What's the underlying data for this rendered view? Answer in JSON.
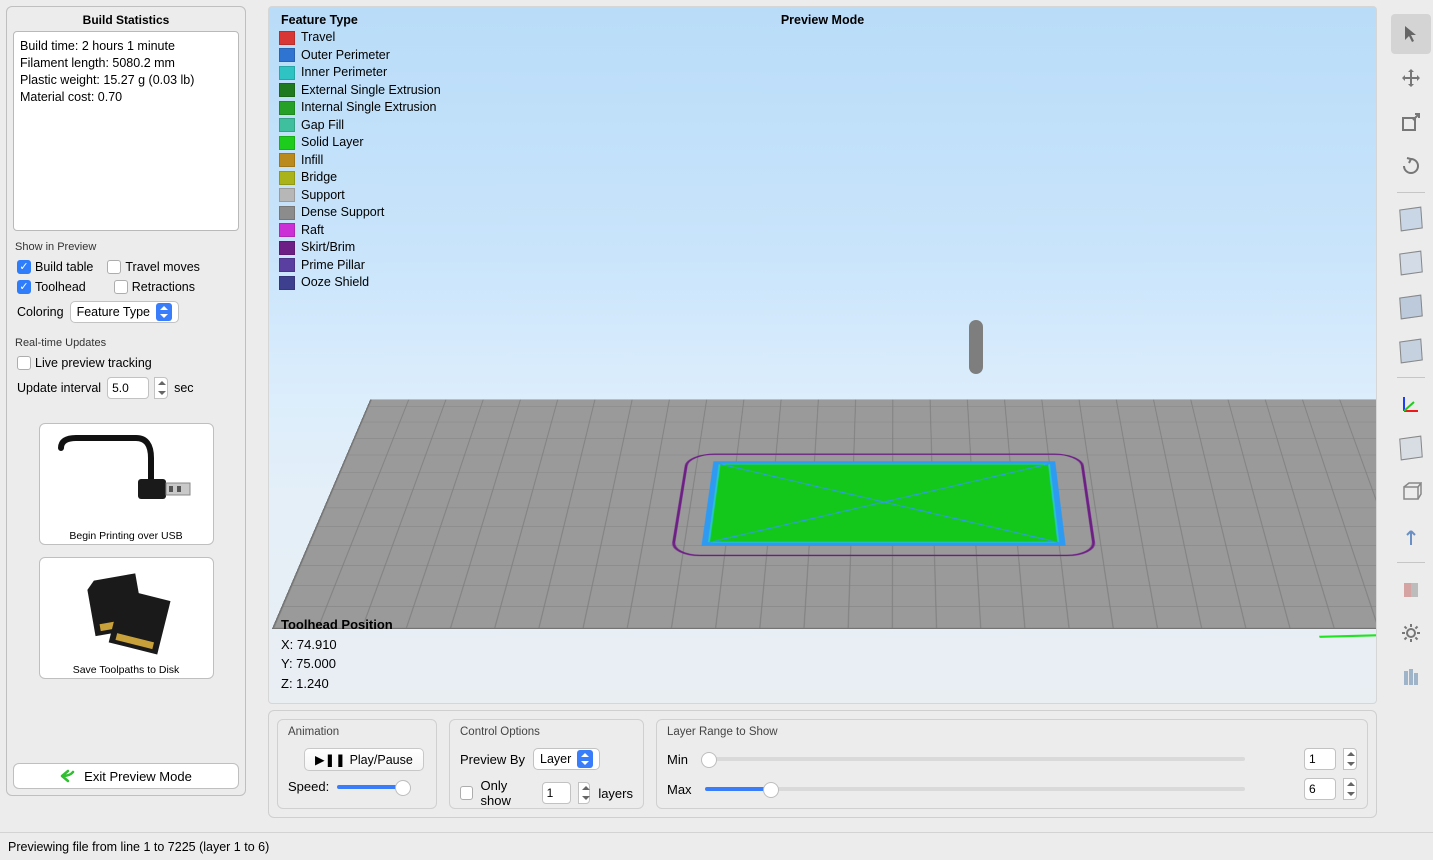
{
  "left": {
    "stats_title": "Build Statistics",
    "stats": {
      "build_time": "Build time: 2 hours 1 minute",
      "filament": "Filament length: 5080.2 mm",
      "weight": "Plastic weight: 15.27 g (0.03 lb)",
      "cost": "Material cost: 0.70"
    },
    "show_in_preview": "Show in Preview",
    "build_table": "Build table",
    "travel_moves": "Travel moves",
    "toolhead": "Toolhead",
    "retractions": "Retractions",
    "coloring_label": "Coloring",
    "coloring_value": "Feature Type",
    "realtime_label": "Real-time Updates",
    "live_preview": "Live preview tracking",
    "update_interval_label": "Update interval",
    "update_interval_value": "5.0",
    "update_interval_unit": "sec",
    "usb_caption": "Begin Printing over USB",
    "disk_caption": "Save Toolpaths to Disk",
    "exit_label": "Exit Preview Mode"
  },
  "legend": {
    "header": "Feature Type",
    "items": [
      {
        "label": "Travel",
        "color": "#d93636"
      },
      {
        "label": "Outer Perimeter",
        "color": "#2f74d0"
      },
      {
        "label": "Inner Perimeter",
        "color": "#2fc3c3"
      },
      {
        "label": "External Single Extrusion",
        "color": "#1f7a1f"
      },
      {
        "label": "Internal Single Extrusion",
        "color": "#27a027"
      },
      {
        "label": "Gap Fill",
        "color": "#3fbf9e"
      },
      {
        "label": "Solid Layer",
        "color": "#1ecc1e"
      },
      {
        "label": "Infill",
        "color": "#bb8a1f"
      },
      {
        "label": "Bridge",
        "color": "#aab41a"
      },
      {
        "label": "Support",
        "color": "#b7b7b7"
      },
      {
        "label": "Dense Support",
        "color": "#8c8c8c"
      },
      {
        "label": "Raft",
        "color": "#cc2fd6"
      },
      {
        "label": "Skirt/Brim",
        "color": "#6e1f86"
      },
      {
        "label": "Prime Pillar",
        "color": "#5a3fa0"
      },
      {
        "label": "Ooze Shield",
        "color": "#3f3f8f"
      }
    ]
  },
  "preview_mode_label": "Preview Mode",
  "toolhead_pos": {
    "header": "Toolhead Position",
    "x": "X: 74.910",
    "y": "Y: 75.000",
    "z": "Z: 1.240"
  },
  "controls": {
    "animation_title": "Animation",
    "play_pause": "Play/Pause",
    "speed_label": "Speed:",
    "options_title": "Control Options",
    "preview_by_label": "Preview By",
    "preview_by_value": "Layer",
    "only_show_prefix": "Only show",
    "only_show_value": "1",
    "only_show_suffix": "layers",
    "range_title": "Layer Range to Show",
    "min_label": "Min",
    "max_label": "Max",
    "min_value": "1",
    "max_value": "6"
  },
  "status": "Previewing file from line 1 to 7225 (layer 1 to 6)"
}
